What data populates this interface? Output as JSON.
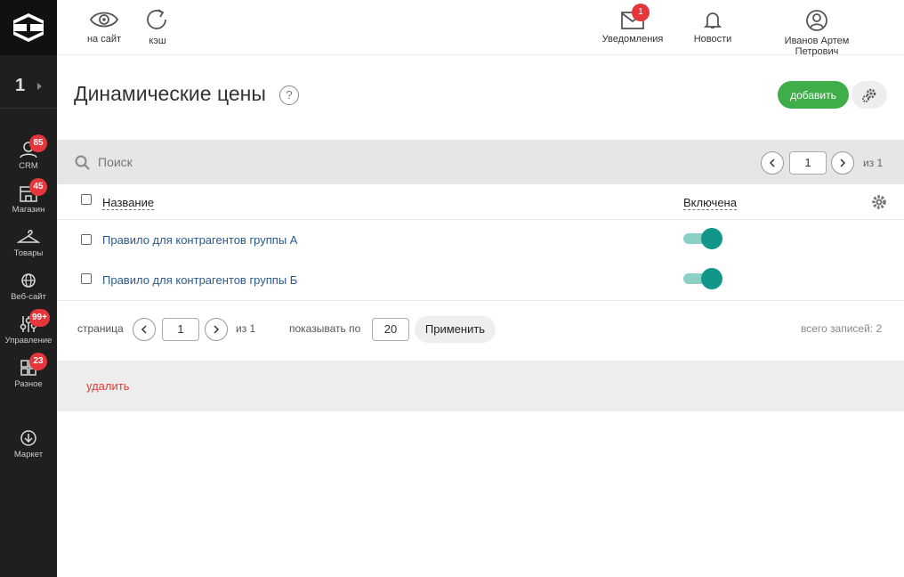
{
  "sidebar": {
    "site_number": "1",
    "items": [
      {
        "label": "CRM",
        "badge": "85",
        "icon": "crm-icon"
      },
      {
        "label": "Магазин",
        "badge": "45",
        "icon": "store-icon"
      },
      {
        "label": "Товары",
        "badge": "",
        "icon": "hanger-icon"
      },
      {
        "label": "Веб-сайт",
        "badge": "",
        "icon": "globe-icon"
      },
      {
        "label": "Управление",
        "badge": "99+",
        "icon": "sliders-icon"
      },
      {
        "label": "Разное",
        "badge": "23",
        "icon": "grid-icon"
      },
      {
        "label": "Маркет",
        "badge": "",
        "icon": "download-circle-icon"
      }
    ]
  },
  "topbar": {
    "view_site_label": "на сайт",
    "cache_label": "кэш",
    "notifications_label": "Уведомления",
    "notifications_badge": "1",
    "news_label": "Новости",
    "user_name": "Иванов Артем Петрович"
  },
  "page": {
    "title": "Динамические цены",
    "help": "?",
    "add_label": "добавить"
  },
  "search": {
    "placeholder": "Поиск",
    "page_value": "1",
    "of_label": "из 1"
  },
  "table": {
    "col_name": "Название",
    "col_enabled": "Включена",
    "rows": [
      {
        "name": "Правило для контрагентов группы А",
        "enabled": true
      },
      {
        "name": "Правило для контрагентов группы Б",
        "enabled": true
      }
    ]
  },
  "pager": {
    "page_label": "страница",
    "page_value": "1",
    "of_label": "из 1",
    "show_label": "показывать по",
    "per_page": "20",
    "apply_label": "Применить",
    "total_label": "всего записей: 2"
  },
  "bottom": {
    "delete_label": "удалить"
  },
  "colors": {
    "accent_green": "#3fae49",
    "toggle_teal": "#119689",
    "badge_red": "#e5363b",
    "link_blue": "#2a5a8c",
    "delete_red": "#e53935"
  }
}
